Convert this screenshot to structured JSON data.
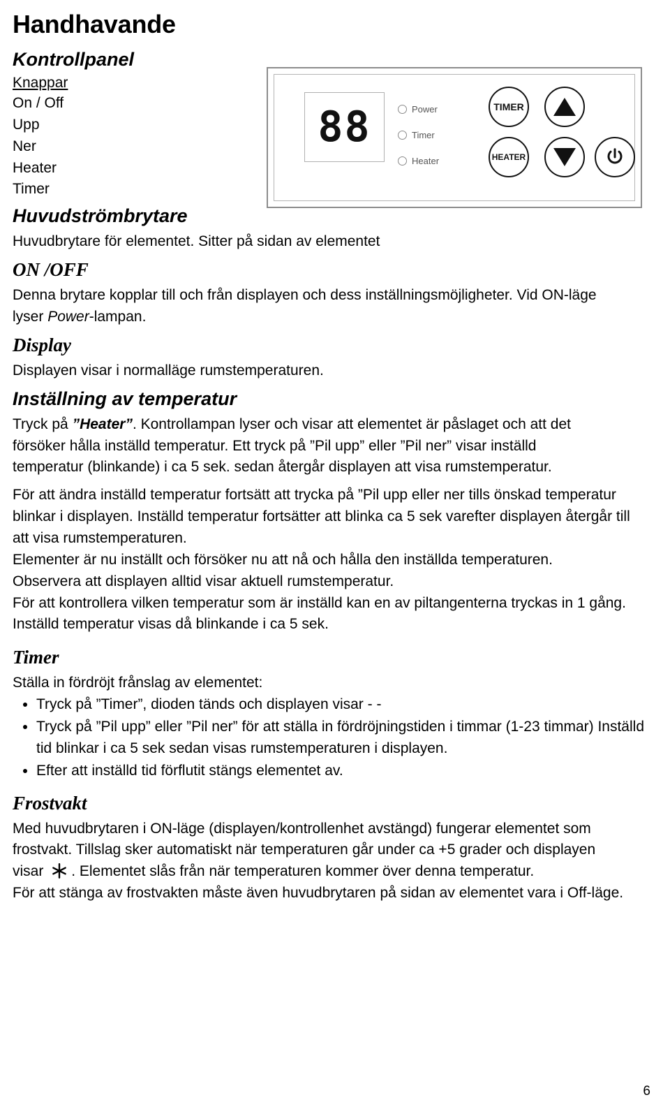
{
  "document": {
    "title": "Handhavande",
    "page_number": "6"
  },
  "sections": {
    "kontrollpanel": {
      "heading": "Kontrollpanel",
      "knappar_label": "Knappar",
      "buttons": [
        "On / Off",
        "Upp",
        "Ner",
        "Heater",
        "Timer"
      ]
    },
    "panel_figure": {
      "display_value": "88",
      "leds": [
        "Power",
        "Timer",
        "Heater"
      ],
      "button_timer": "TIMER",
      "button_heater": "HEATER",
      "button_up_icon": "triangle-up-icon",
      "button_down_icon": "triangle-down-icon",
      "button_power_icon": "power-icon"
    },
    "huvudstrombrytare": {
      "heading": "Huvudströmbrytare",
      "text": "Huvudbrytare för elementet.  Sitter på sidan av elementet"
    },
    "on_off": {
      "heading": "ON /OFF",
      "line1_a": "Denna brytare kopplar till och från displayen och dess inställningsmöjligheter. Vid ON-läge",
      "line2_a": "lyser ",
      "line2_em": "Power",
      "line2_b": "-lampan."
    },
    "display": {
      "heading": "Display",
      "text": "Displayen visar i normalläge rumstemperaturen."
    },
    "installning": {
      "heading": "Inställning av temperatur",
      "p1_a": "Tryck på ",
      "p1_em": "”Heater”",
      "p1_b": ". Kontrollampan lyser och visar att elementet är påslaget och att det",
      "p1_c": "försöker hålla inställd temperatur. Ett tryck på ”Pil upp” eller ”Pil ner” visar inställd",
      "p1_d": "temperatur (blinkande) i ca 5 sek. sedan återgår displayen att visa rumstemperatur.",
      "p2": " För att ändra inställd temperatur fortsätt att trycka på ”Pil upp eller ner tills önskad temperatur blinkar i displayen.  Inställd temperatur fortsätter att blinka ca 5 sek varefter displayen återgår till att visa rumstemperaturen.",
      "p3": "Elementer är nu inställt och försöker nu att nå och hålla den inställda temperaturen.",
      "p4": "Observera att displayen alltid visar aktuell rumstemperatur.",
      "p5": "För att kontrollera vilken temperatur som är inställd kan en av piltangenterna tryckas in 1 gång. Inställd temperatur visas då blinkande i ca 5 sek."
    },
    "timer": {
      "heading": "Timer",
      "intro": "Ställa in fördröjt frånslag av elementet:",
      "items": [
        "Tryck på ”Timer”, dioden tänds och displayen visar - -",
        "Tryck på ”Pil upp” eller ”Pil ner” för att ställa in fördröjningstiden i timmar (1-23 timmar) Inställd tid blinkar i ca 5 sek sedan visas rumstemperaturen i displayen.",
        "Efter att inställd tid förflutit stängs elementet av."
      ]
    },
    "frostvakt": {
      "heading": "Frostvakt",
      "p1": "Med huvudbrytaren i ON-läge (displayen/kontrollenhet avstängd) fungerar elementet som frostvakt. Tillslag sker automatiskt när temperaturen går under ca +5 grader och displayen",
      "p2_a": "visar ",
      "p2_icon": "frost-icon",
      "p2_b": ". Elementet slås från när temperaturen kommer över denna temperatur.",
      "p3": "För att stänga av frostvakten måste även huvudbrytaren på sidan av elementet vara i Off-läge."
    }
  }
}
